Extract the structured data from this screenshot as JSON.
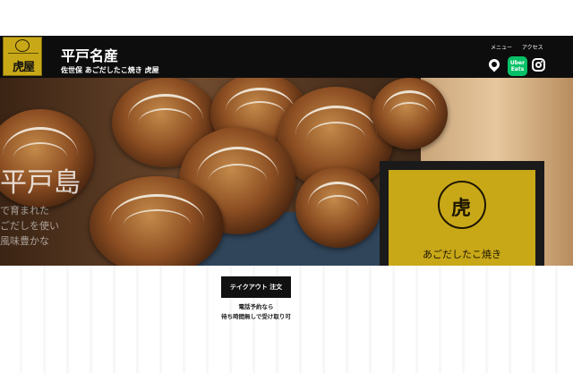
{
  "header": {
    "logo_text": "虎屋",
    "title": "平戸名産",
    "subtitle": "佐世保 あごだしたこ焼き 虎屋",
    "nav": [
      "メニュー",
      "アクセス"
    ],
    "icons": [
      "map-pin-icon",
      "uber-eats-icon",
      "instagram-icon"
    ],
    "uber_label_1": "Uber",
    "uber_label_2": "Eats"
  },
  "hero": {
    "text_main": "平戸島",
    "ghost_line_1": "で育まれた",
    "ghost_line_2": "ごだしを使い",
    "ghost_line_3": "風味豊かな",
    "card_glyph": "虎",
    "card_text": "あごだしたこ焼き"
  },
  "cta": {
    "button_label": "テイクアウト 注文",
    "note_line_1": "電話予約なら",
    "note_line_2": "待ち時間無しで受け取り可"
  },
  "colors": {
    "brand_gold": "#c9a818",
    "header_bg": "#0d0d0d",
    "uber_green": "#06c167"
  }
}
